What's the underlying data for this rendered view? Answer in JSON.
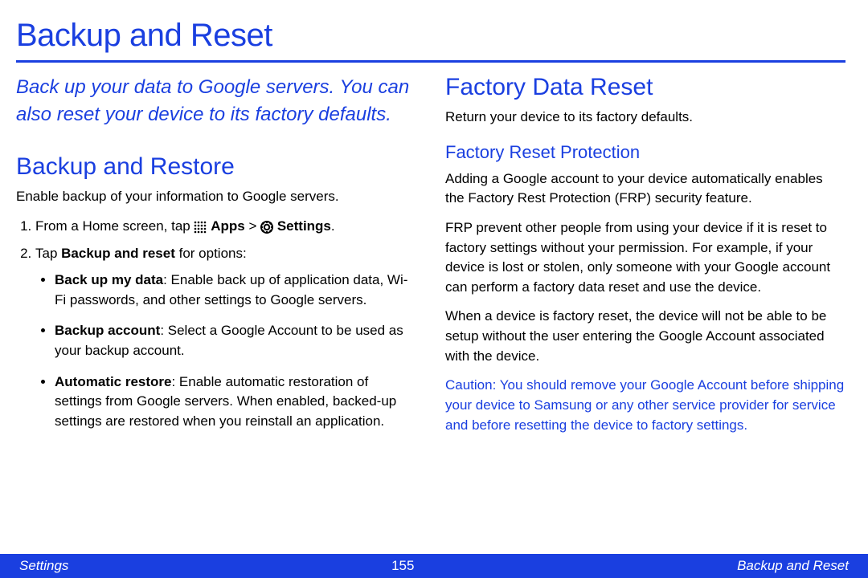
{
  "title": "Backup and Reset",
  "intro": "Back up your data to Google servers. You can also reset your device to its factory defaults.",
  "section1": {
    "heading": "Backup and Restore",
    "lead": "Enable backup of your information to Google servers.",
    "step1_pre": "From a Home screen, tap ",
    "apps_label": "Apps",
    "gt": " > ",
    "settings_label": "Settings",
    "step1_post": ".",
    "step2_pre": "Tap ",
    "step2_bold": "Backup and reset",
    "step2_post": " for options:",
    "bullets": [
      {
        "term": "Back up my data",
        "desc": ": Enable back up of application data, Wi-Fi passwords, and other settings to Google servers."
      },
      {
        "term": "Backup account",
        "desc": ": Select a Google Account to be used as your backup account."
      },
      {
        "term": "Automatic restore",
        "desc": ": Enable automatic restoration of settings from Google servers. When enabled, backed-up settings are restored when you reinstall an application."
      }
    ]
  },
  "section2": {
    "heading": "Factory Data Reset",
    "lead": "Return your device to its factory defaults.",
    "sub_heading": "Factory Reset Protection",
    "p1": "Adding a Google account to your device automatically enables the Factory Rest Protection (FRP) security feature.",
    "p2": "FRP prevent other people from using your device if it is reset to factory settings without your permission. For example, if your device is lost or stolen, only someone with your Google account can perform a factory data reset and use the device.",
    "p3": "When a device is factory reset, the device will not be able to be setup without the user entering the Google Account associated with the device.",
    "caution_label": "Caution",
    "caution_text": ": You should remove your Google Account before shipping your device to Samsung or any other service provider for service and before resetting the device to factory settings."
  },
  "footer": {
    "left": "Settings",
    "page": "155",
    "right": "Backup and Reset"
  }
}
